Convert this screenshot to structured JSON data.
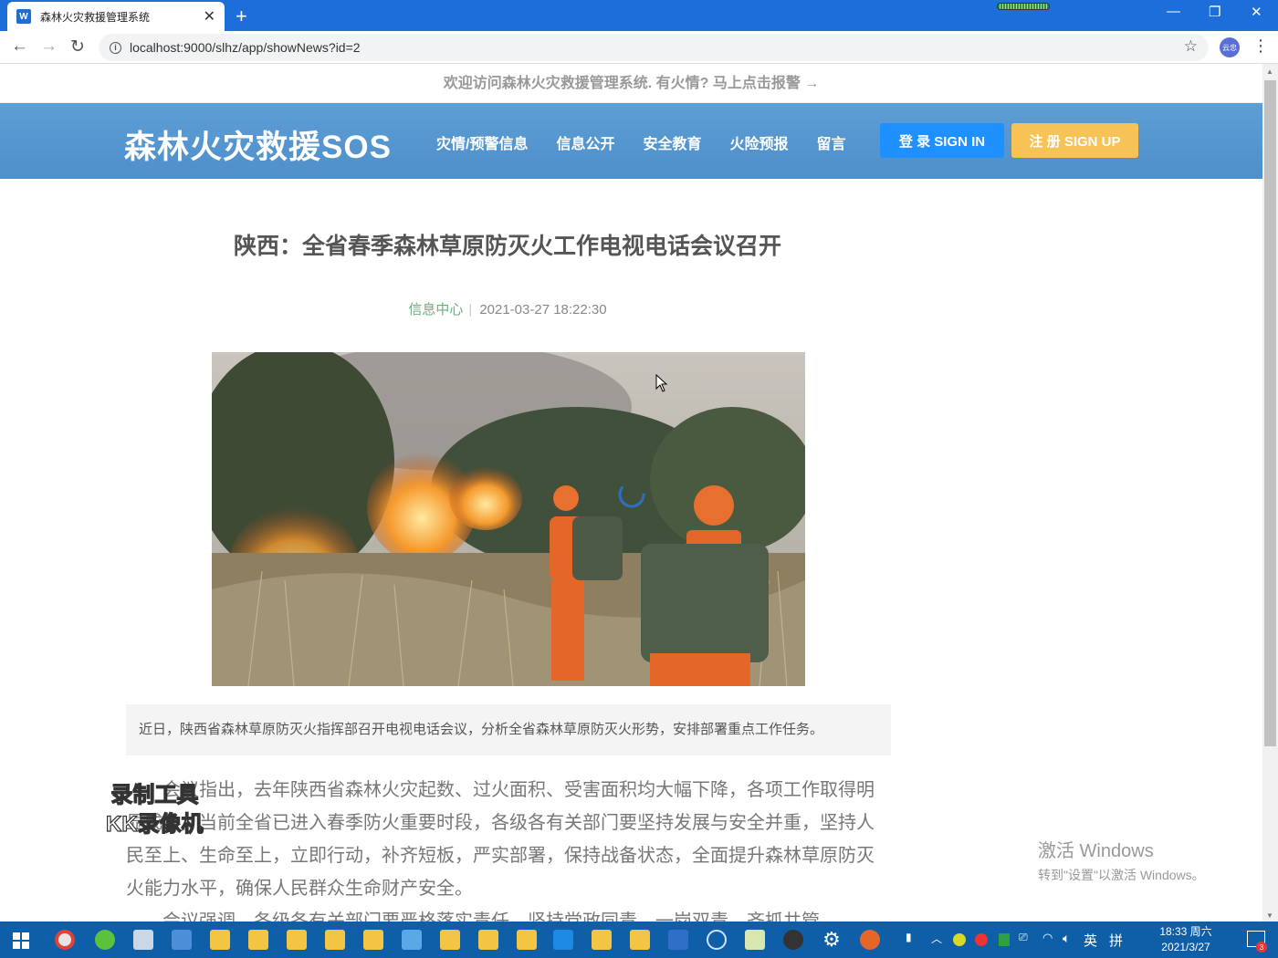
{
  "browser": {
    "tab_title": "森林火灾救援管理系统",
    "tab_favicon": "W",
    "url": "localhost:9000/slhz/app/showNews?id=2",
    "profile_label": "云忠"
  },
  "notice_bar": "欢迎访问森林火灾救援管理系统. 有火情? 马上点击报警 →",
  "header": {
    "logo": "森林火灾救援SOS",
    "nav": [
      "灾情/预警信息",
      "信息公开",
      "安全教育",
      "火险预报",
      "留言"
    ],
    "signin": "登 录 SIGN IN",
    "signup": "注 册 SIGN UP",
    "colors": {
      "header_bg": "#5b9bd5",
      "signin_bg": "#1e90ff",
      "signup_bg": "#f7c256"
    }
  },
  "article": {
    "title": "陕西：全省春季森林草原防灭火工作电视电话会议召开",
    "category": "信息中心",
    "separator": "|",
    "datetime": "2021-03-27 18:22:30",
    "summary": "近日，陕西省森林草原防灭火指挥部召开电视电话会议，分析全省森林草原防灭火形势，安排部署重点工作任务。",
    "paragraphs": [
      "会议指出，去年陕西省森林火灾起数、过火面积、受害面积均大幅下降，各项工作取得明显成效。当前全省已进入春季防火重要时段，各级各有关部门要坚持发展与安全并重，坚持人民至上、生命至上，立即行动，补齐短板，严实部署，保持战备状态，全面提升森林草原防灭火能力水平，确保人民群众生命财产安全。",
      "会议强调，各级各有关部门要严格落实责任，坚持党政同责、一岗双责，齐抓共管"
    ]
  },
  "overlays": {
    "watermark_line1": "录制工具",
    "watermark_line2": "KK录像机",
    "activate_line1": "激活 Windows",
    "activate_line2": "转到\"设置\"以激活 Windows。"
  },
  "taskbar": {
    "ime_lang": "英",
    "ime_mode": "拼",
    "time": "18:33 周六",
    "date": "2021/3/27",
    "notification_count": "3"
  }
}
